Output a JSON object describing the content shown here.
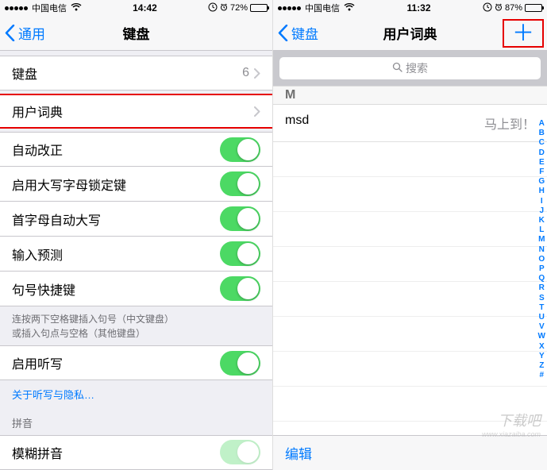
{
  "left": {
    "status": {
      "carrier": "中国电信",
      "time": "14:42",
      "battery_pct": "72%",
      "battery_fill": 72
    },
    "nav": {
      "back": "通用",
      "title": "键盘"
    },
    "keyboards": {
      "label": "键盘",
      "count": "6"
    },
    "user_dict": {
      "label": "用户词典"
    },
    "toggles": {
      "autocorrect": "自动改正",
      "caps_lock": "启用大写字母锁定键",
      "auto_cap": "首字母自动大写",
      "predictive": "输入预测",
      "period_shortcut": "句号快捷键"
    },
    "period_note_l1": "连按两下空格键插入句号（中文键盘）",
    "period_note_l2": "或插入句点与空格（其他键盘）",
    "dictation": {
      "label": "启用听写"
    },
    "dictation_link": "关于听写与隐私…",
    "pinyin_header": "拼音",
    "fuzzy": {
      "label": "模糊拼音"
    }
  },
  "right": {
    "status": {
      "carrier": "中国电信",
      "time": "11:32",
      "battery_pct": "87%",
      "battery_fill": 87
    },
    "nav": {
      "back": "键盘",
      "title": "用户词典"
    },
    "search_placeholder": "搜索",
    "section": "M",
    "entry": {
      "shortcut": "msd",
      "phrase": "马上到！"
    },
    "toolbar_edit": "编辑",
    "index": [
      "A",
      "B",
      "C",
      "D",
      "E",
      "F",
      "G",
      "H",
      "I",
      "J",
      "K",
      "L",
      "M",
      "N",
      "O",
      "P",
      "Q",
      "R",
      "S",
      "T",
      "U",
      "V",
      "W",
      "X",
      "Y",
      "Z",
      "#"
    ]
  },
  "watermark": {
    "big": "下载吧",
    "small": "www.xiazaiba.com"
  }
}
